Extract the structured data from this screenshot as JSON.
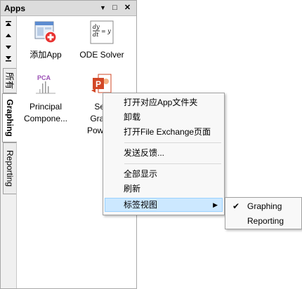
{
  "panel": {
    "title": "Apps",
    "buttons": {
      "dropdown": "▼",
      "undock": "□",
      "close": "✕"
    }
  },
  "side_tabs": [
    {
      "label": "所有",
      "active": false
    },
    {
      "label": "Graphing",
      "active": true
    },
    {
      "label": "Reporting",
      "active": false
    }
  ],
  "apps": [
    {
      "label": "添加App",
      "icon": "add-app-icon"
    },
    {
      "label": "ODE Solver",
      "icon": "ode-solver-icon",
      "icon_text": "dy/dt = y"
    },
    {
      "label1": "Principal",
      "label2": "Compone...",
      "icon": "pca-icon",
      "icon_text": "PCA"
    },
    {
      "label1": "Sen",
      "label2": "Graph",
      "label3": "PowerP",
      "icon": "powerpoint-icon",
      "icon_text": "P"
    }
  ],
  "context_menu": {
    "items": [
      {
        "label": "打开对应App文件夹"
      },
      {
        "label": "卸载"
      },
      {
        "label": "打开File Exchange页面"
      },
      {
        "label": "发送反馈..."
      },
      {
        "label": "全部显示"
      },
      {
        "label": "刷新"
      },
      {
        "label": "标签视图",
        "has_submenu": true,
        "highlighted": true
      }
    ]
  },
  "submenu": {
    "items": [
      {
        "label": "Graphing",
        "checked": true
      },
      {
        "label": "Reporting",
        "checked": false
      }
    ]
  },
  "colors": {
    "highlight": "#cce8ff",
    "pca_purple": "#9b4fb5",
    "ppt_orange": "#d24726",
    "add_red": "#e8312f"
  }
}
